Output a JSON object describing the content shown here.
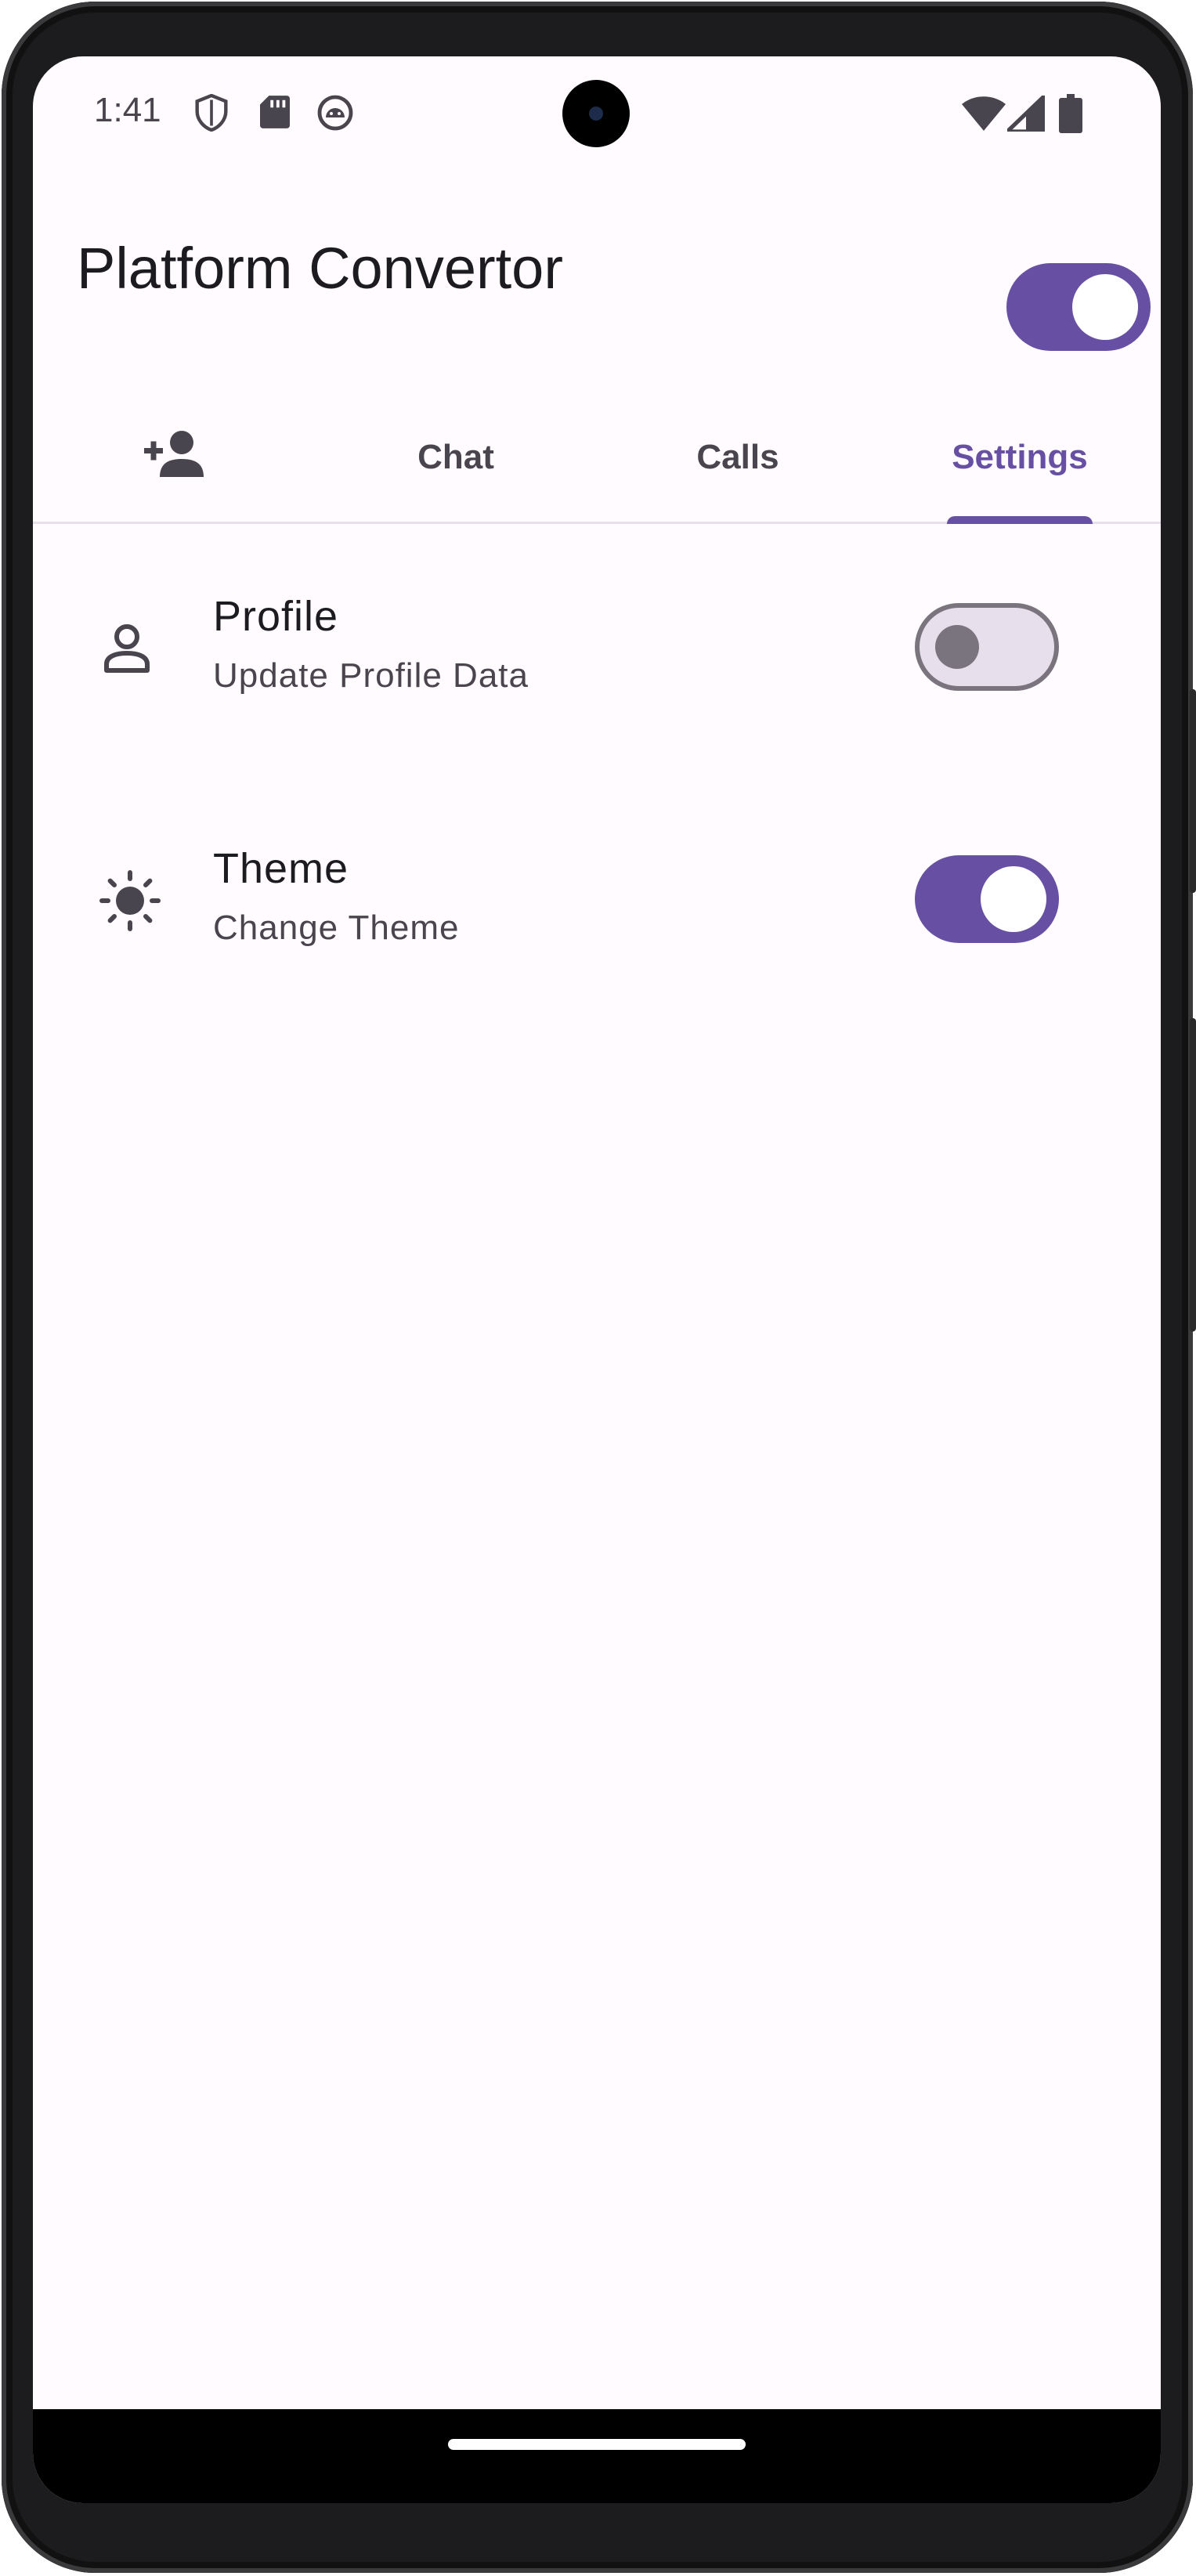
{
  "status_bar": {
    "time": "1:41",
    "icons_left": [
      "shield-icon",
      "sd-card-icon",
      "android-debug-icon"
    ],
    "icons_right": [
      "wifi-icon",
      "signal-icon",
      "battery-icon"
    ]
  },
  "app_bar": {
    "title": "Platform Convertor",
    "platform_switch_on": true
  },
  "tabs": [
    {
      "label": "",
      "icon": "person-add-icon",
      "active": false
    },
    {
      "label": "Chat",
      "active": false
    },
    {
      "label": "Calls",
      "active": false
    },
    {
      "label": "Settings",
      "active": true
    }
  ],
  "settings": [
    {
      "icon": "person-icon",
      "title": "Profile",
      "subtitle": "Update Profile Data",
      "enabled": false
    },
    {
      "icon": "sun-icon",
      "title": "Theme",
      "subtitle": "Change Theme",
      "enabled": true
    }
  ],
  "colors": {
    "primary": "#6750a4",
    "background": "#fffbfe",
    "on_surface": "#1c1b1f",
    "on_surface_variant": "#49454f",
    "outline": "#79747e"
  }
}
